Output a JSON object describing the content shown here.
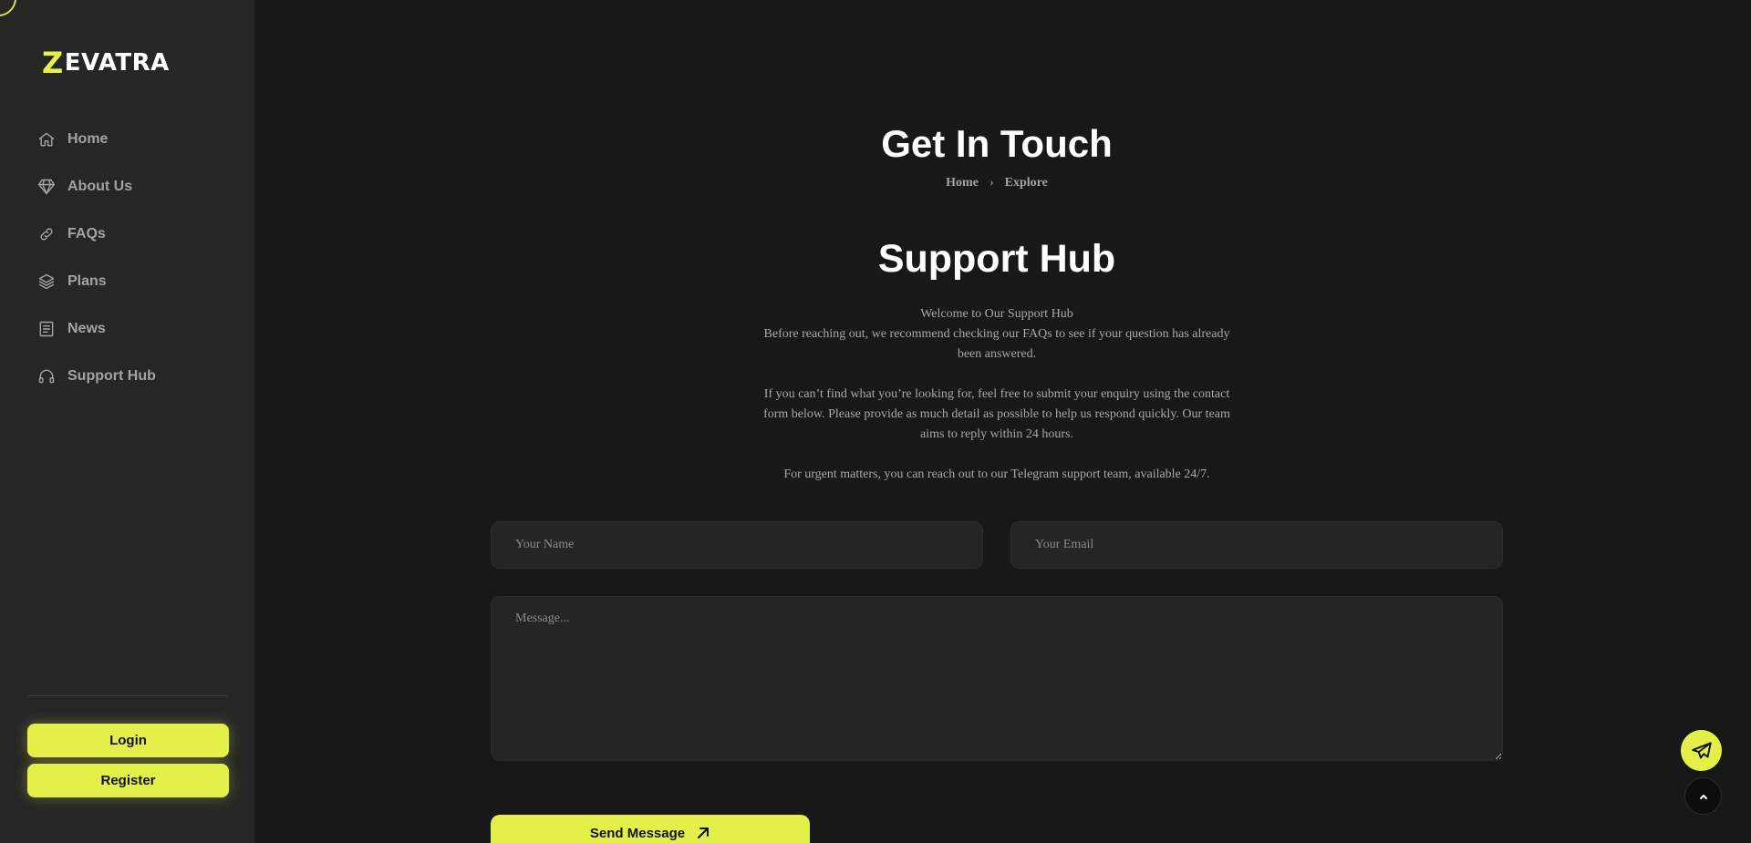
{
  "brand": {
    "logo_mark": "Z",
    "logo_text": "EVATRA",
    "accent_color": "#e4f04a"
  },
  "sidebar": {
    "items": [
      {
        "label": "Home",
        "icon": "home-icon"
      },
      {
        "label": "About Us",
        "icon": "diamond-icon"
      },
      {
        "label": "FAQs",
        "icon": "link-icon"
      },
      {
        "label": "Plans",
        "icon": "layers-icon"
      },
      {
        "label": "News",
        "icon": "receipt-icon"
      },
      {
        "label": "Support Hub",
        "icon": "headset-icon"
      }
    ],
    "login_label": "Login",
    "register_label": "Register"
  },
  "hero": {
    "title": "Get In Touch",
    "breadcrumb": [
      "Home",
      "Explore"
    ],
    "breadcrumb_separator": "›"
  },
  "support": {
    "title": "Support Hub",
    "welcome": "Welcome to Our Support Hub",
    "para1": "Before reaching out, we recommend checking our FAQs to see if your question has already been answered.",
    "para2": "If you can’t find what you’re looking for, feel free to submit your enquiry using the contact form below. Please provide as much detail as possible to help us respond quickly. Our team aims to reply within 24 hours.",
    "para3": "For urgent matters, you can reach out to our Telegram support team, available 24/7."
  },
  "form": {
    "name_placeholder": "Your Name",
    "name_value": "",
    "email_placeholder": "Your Email",
    "email_value": "",
    "message_placeholder": "Message...",
    "message_value": "",
    "send_label": "Send Message"
  },
  "floating": {
    "telegram_icon": "telegram-icon",
    "top_icon": "chevron-up-icon"
  }
}
